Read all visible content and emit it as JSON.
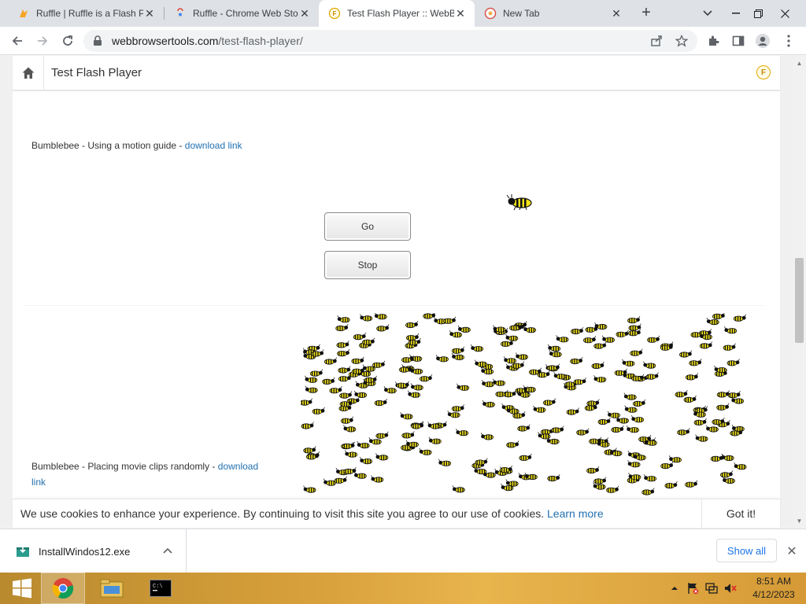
{
  "browser": {
    "tabs": [
      {
        "title": "Ruffle | Ruffle is a Flash P",
        "icon": "ruffle-icon",
        "active": false
      },
      {
        "title": "Ruffle - Chrome Web Sto",
        "icon": "chrome-web-store-icon",
        "active": false
      },
      {
        "title": "Test Flash Player :: WebB",
        "icon": "flash-f-icon",
        "active": true
      },
      {
        "title": "New Tab",
        "icon": "new-tab-icon",
        "active": false
      }
    ],
    "url_host": "webbrowsertools.com",
    "url_path": "/test-flash-player/"
  },
  "site": {
    "title": "Test Flash Player",
    "badge": "F"
  },
  "section1": {
    "label": "Bumblebee - Using a motion guide - ",
    "link": "download link",
    "go_label": "Go",
    "stop_label": "Stop"
  },
  "section2": {
    "label": "Bumblebee - Placing movie clips randomly - ",
    "link_part1": "download",
    "link_part2": "link"
  },
  "cookie": {
    "text": "We use cookies to enhance your experience. By continuing to visit this site you agree to our use of cookies. ",
    "learn_more": "Learn more",
    "ok_label": "Got it!"
  },
  "download": {
    "filename": "InstallWindos12.exe",
    "show_all": "Show all"
  },
  "taskbar": {
    "time": "8:51 AM",
    "date": "4/12/2023"
  },
  "colors": {
    "link": "#2271b1",
    "bee_yellow": "#f2e21a",
    "taskbar": "#d9a13c"
  }
}
